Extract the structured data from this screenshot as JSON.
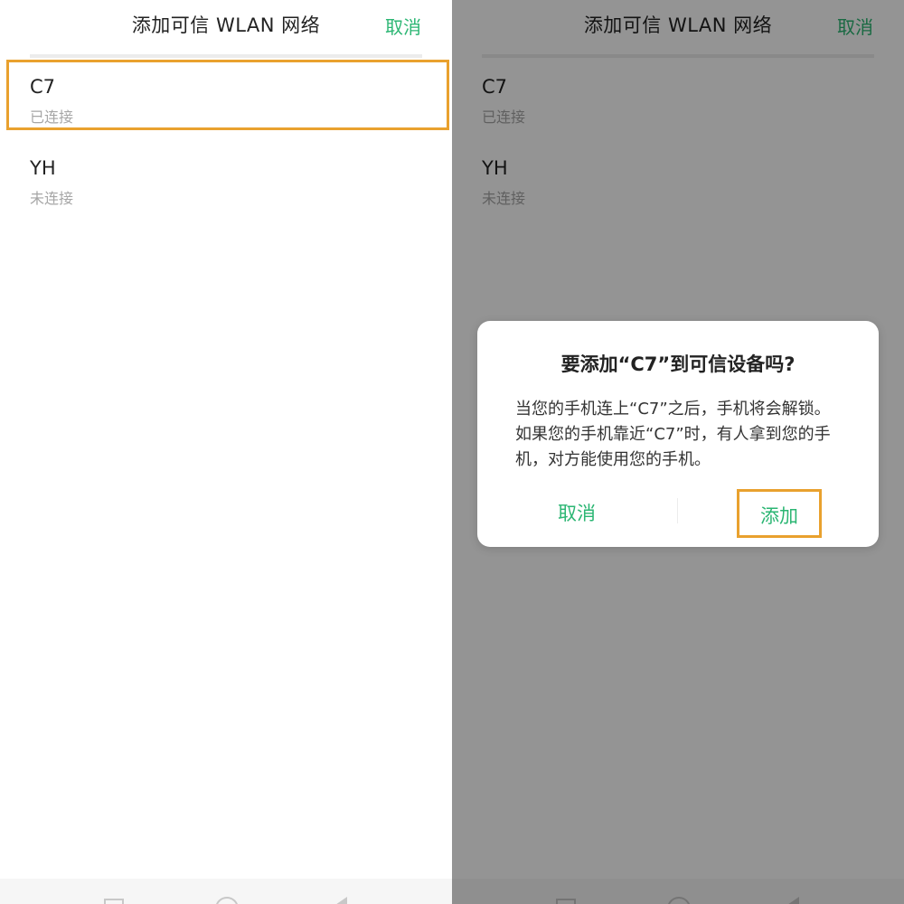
{
  "left": {
    "title": "添加可信 WLAN 网络",
    "cancel_label": "取消",
    "networks": [
      {
        "name": "C7",
        "status": "已连接"
      },
      {
        "name": "YH",
        "status": "未连接"
      }
    ]
  },
  "right": {
    "title": "添加可信 WLAN 网络",
    "cancel_label": "取消",
    "networks": [
      {
        "name": "C7",
        "status": "已连接"
      },
      {
        "name": "YH",
        "status": "未连接"
      }
    ],
    "dialog": {
      "title": "要添加“C7”到可信设备吗?",
      "body": "当您的手机连上“C7”之后，手机将会解锁。如果您的手机靠近“C7”时，有人拿到您的手机，对方能使用您的手机。",
      "cancel_label": "取消",
      "add_label": "添加"
    }
  },
  "colors": {
    "accent": "#2bb673",
    "highlight": "#e9a12e",
    "overlay": "rgba(0,0,0,0.42)"
  },
  "icons": [
    "nav-recent-square-icon",
    "nav-home-circle-icon",
    "nav-back-triangle-icon"
  ]
}
